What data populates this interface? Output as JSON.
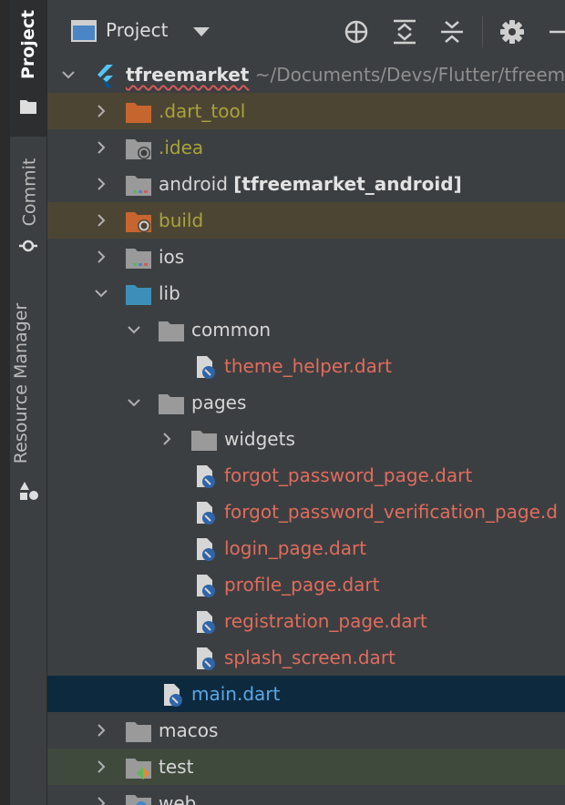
{
  "sidebar": {
    "tabs": [
      {
        "label": "Project"
      },
      {
        "label": "Commit"
      },
      {
        "label": "Resource Manager"
      }
    ]
  },
  "header": {
    "title": "Project",
    "buttons": [
      "locate-icon",
      "expand-all-icon",
      "collapse-all-icon",
      "gear-icon",
      "hide-icon"
    ]
  },
  "tree": {
    "root": {
      "name": "tfreemarket",
      "path": "~/Documents/Devs/Flutter/tfreema"
    },
    "rows": [
      {
        "name": ".dart_tool"
      },
      {
        "name": ".idea"
      },
      {
        "name": "android",
        "suffix": "[tfreemarket_android]"
      },
      {
        "name": "build"
      },
      {
        "name": "ios"
      },
      {
        "name": "lib"
      },
      {
        "name": "common"
      },
      {
        "name": "theme_helper.dart"
      },
      {
        "name": "pages"
      },
      {
        "name": "widgets"
      },
      {
        "name": "forgot_password_page.dart"
      },
      {
        "name": "forgot_password_verification_page.d"
      },
      {
        "name": "login_page.dart"
      },
      {
        "name": "profile_page.dart"
      },
      {
        "name": "registration_page.dart"
      },
      {
        "name": "splash_screen.dart"
      },
      {
        "name": "main.dart"
      },
      {
        "name": "macos"
      },
      {
        "name": "test"
      },
      {
        "name": "web"
      }
    ]
  },
  "colors": {
    "excluded_bg": "#4d4534",
    "test_bg": "#3f4a3d",
    "selected_bg": "#0d293e",
    "error_text": "#e06c5d",
    "excluded_text": "#a8a33a"
  }
}
